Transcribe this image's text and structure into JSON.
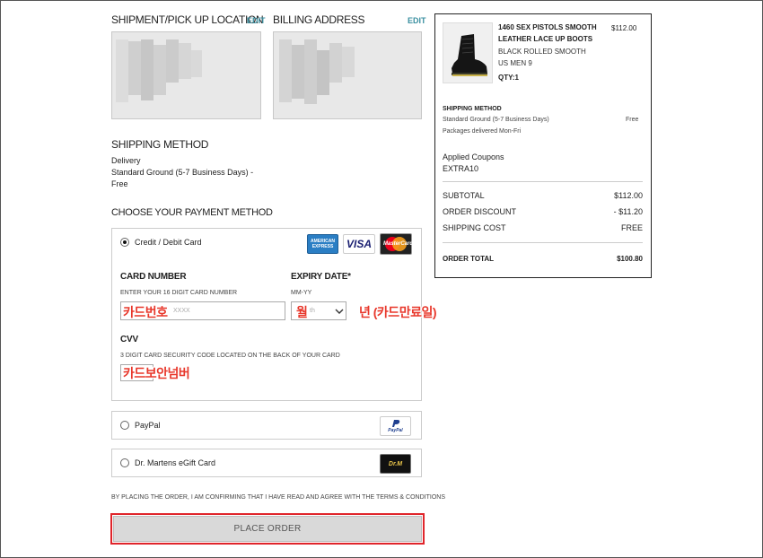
{
  "shipment": {
    "title": "SHIPMENT/PICK UP LOCATION",
    "edit": "EDIT"
  },
  "billing": {
    "title": "BILLING ADDRESS",
    "edit": "EDIT"
  },
  "shipping_method": {
    "title": "SHIPPING METHOD",
    "line1": "Delivery",
    "line2": "Standard Ground (5-7 Business Days) -",
    "line3": "Free"
  },
  "payment": {
    "title": "CHOOSE YOUR PAYMENT METHOD",
    "credit_label": "Credit / Debit Card",
    "card_logos": {
      "amex": "AMERICAN EXPRESS",
      "visa": "VISA",
      "mastercard": "MasterCard"
    },
    "card_number": {
      "label": "CARD NUMBER",
      "hint": "ENTER YOUR 16 DIGIT CARD NUMBER",
      "placeholder": "XXXX",
      "annotation": "카드번호"
    },
    "expiry": {
      "label": "EXPIRY DATE*",
      "hint": "MM-YY",
      "month_placeholder": "th",
      "month_annotation": "월",
      "year_annotation": "년 (카드만료일)"
    },
    "cvv": {
      "label": "CVV",
      "hint": "3 DIGIT CARD SECURITY CODE LOCATED ON THE BACK OF YOUR CARD",
      "annotation": "카드보안넘버"
    },
    "paypal_label": "PayPal",
    "paypal_logo": "PayPal",
    "giftcard_label": "Dr. Martens eGift Card",
    "giftcard_logo": "Dr.M"
  },
  "terms": {
    "text": "BY PLACING THE ORDER, I AM CONFIRMING THAT I HAVE READ AND AGREE WITH THE",
    "link": "TERMS & CONDITIONS"
  },
  "place_order": "PLACE ORDER",
  "summary": {
    "product": {
      "name_line1": "1460 SEX PISTOLS SMOOTH",
      "name_line2": "LEATHER LACE UP BOOTS",
      "color": "BLACK ROLLED SMOOTH",
      "size": "US MEN 9",
      "qty": "QTY:1",
      "price": "$112.00"
    },
    "shipping": {
      "title": "SHIPPING METHOD",
      "method": "Standard Ground (5-7 Business Days)",
      "method_price": "Free",
      "note": "Packages delivered Mon-Fri"
    },
    "coupons": {
      "title": "Applied Coupons",
      "code": "EXTRA10"
    },
    "subtotal": {
      "label": "SUBTOTAL",
      "value": "$112.00"
    },
    "discount": {
      "label": "ORDER DISCOUNT",
      "value": "- $11.20"
    },
    "shipping_cost": {
      "label": "SHIPPING COST",
      "value": "FREE"
    },
    "total": {
      "label": "ORDER TOTAL",
      "value": "$100.80"
    }
  },
  "colors": {
    "accent_link": "#3a8fa0",
    "annotation_red": "#e8372b",
    "highlight_ring": "#e0252b"
  }
}
